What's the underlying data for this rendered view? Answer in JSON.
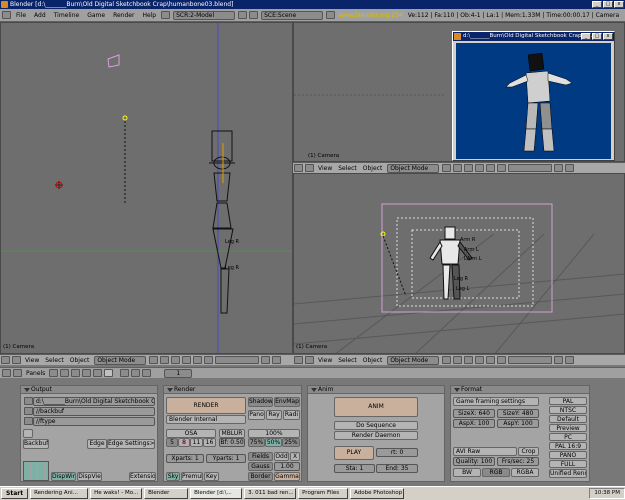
{
  "window": {
    "title": "Blender [d:\\_______Burn\\Old Digital Sketchbook Crap\\humanbone03.blend]",
    "min": "_",
    "max": "□",
    "close": "x"
  },
  "menubar": {
    "items": [
      "File",
      "Add",
      "Timeline",
      "Game",
      "Render",
      "Help"
    ],
    "screen": "SCR:2-Model",
    "scene": "SCE:Scene",
    "url": "www.blender.org 234",
    "stats": "Ve:112 | Fa:110 | Ob:4-1 | La:1 | Mem:1.33M | Time:00:00.17 | Camera"
  },
  "viewport_left": {
    "label": "(1) Camera",
    "bones": [
      "Leg R",
      "Leg R"
    ],
    "header": {
      "view": "View",
      "select": "Select",
      "object": "Object",
      "mode": "Object Mode"
    }
  },
  "viewport_topright": {
    "label": "(1) Camera",
    "header": {
      "view": "View",
      "select": "Select",
      "object": "Object",
      "mode": "Object Mode"
    }
  },
  "viewport_bottomright": {
    "label": "(1) Camera",
    "bones": [
      "Arm R",
      "Arm L",
      "LArm L",
      "Leg R",
      "Leg L"
    ],
    "header": {
      "view": "View",
      "select": "Select",
      "object": "Object",
      "mode": "Object Mode"
    }
  },
  "popup": {
    "title": "d:\\_______Burn\\Old Digital Sketchbook Crap\\h...",
    "buttons": [
      "_",
      "□",
      "x"
    ]
  },
  "buttons_header": {
    "panels": "Panels",
    "frame": "1"
  },
  "output": {
    "title": "Output",
    "path1": "d:\\_______Burn\\Old Digital Sketchbook Crap\\",
    "path2": "//backbuf",
    "path3": "//ftype",
    "backbuf": "Backbuf",
    "edge": "Edge",
    "edge_settings": "Edge Settings>>",
    "dispwin": "DispWin",
    "dispview": "DispVie",
    "extensions": "Extensio"
  },
  "render": {
    "title": "Render",
    "render_btn": "RENDER",
    "engine": "Blender Internal",
    "shadow": "Shadow",
    "envmap": "EnvMap",
    "pano": "Pano",
    "ray": "Ray",
    "radio": "Radi",
    "osa": "OSA",
    "mblur": "MBLUR",
    "osa_vals": [
      "5",
      "8",
      "11",
      "16"
    ],
    "bf": "Bf: 0.50",
    "pct_100": "100%",
    "pct_75": "75%",
    "pct_50": "50%",
    "pct_25": "25%",
    "xparts": "Xparts: 1",
    "yparts": "Yparts: 1",
    "fields": "Fields",
    "odd": "Odd",
    "x": "X",
    "gauss": "Gauss",
    "gauss_val": "1.00",
    "sky": "Sky",
    "premul": "Premul",
    "key": "Key",
    "border": "Border",
    "gamma": "Gamma"
  },
  "anim": {
    "title": "Anim",
    "anim_btn": "ANIM",
    "do_sequence": "Do Sequence",
    "render_daemon": "Render Daemon",
    "play": "PLAY",
    "rt": "rt: 0",
    "sta": "Sta: 1",
    "end": "End: 35"
  },
  "format": {
    "title": "Format",
    "game_framing": "Game framing settings",
    "sizex": "SizeX: 640",
    "sizey": "SizeY: 480",
    "aspx": "AspX: 100",
    "aspy": "AspY: 100",
    "codec": "AVI Raw",
    "crop": "Crop",
    "quality": "Quality: 100",
    "fps": "Frs/sec: 25",
    "bw": "BW",
    "rgb": "RGB",
    "rgba": "RGBA",
    "presets": [
      "PAL",
      "NTSC",
      "Default",
      "Preview",
      "PC",
      "PAL 16:9",
      "PANO",
      "FULL",
      "Unified Rend"
    ]
  },
  "taskbar": {
    "start": "Start",
    "items": [
      "Rendering Ani...",
      "He waks! - Mo...",
      "Blender",
      "Blender [d:\\...",
      "3. 011 bad ren...",
      "Program Files",
      "Adobe Photoshop"
    ],
    "time": "10:38 PM"
  },
  "colors": {
    "titlebar": "#0a246a",
    "viewport": "#6e6e6e",
    "popup_bg": "#003a82",
    "render_btn": "#c8b09c"
  }
}
